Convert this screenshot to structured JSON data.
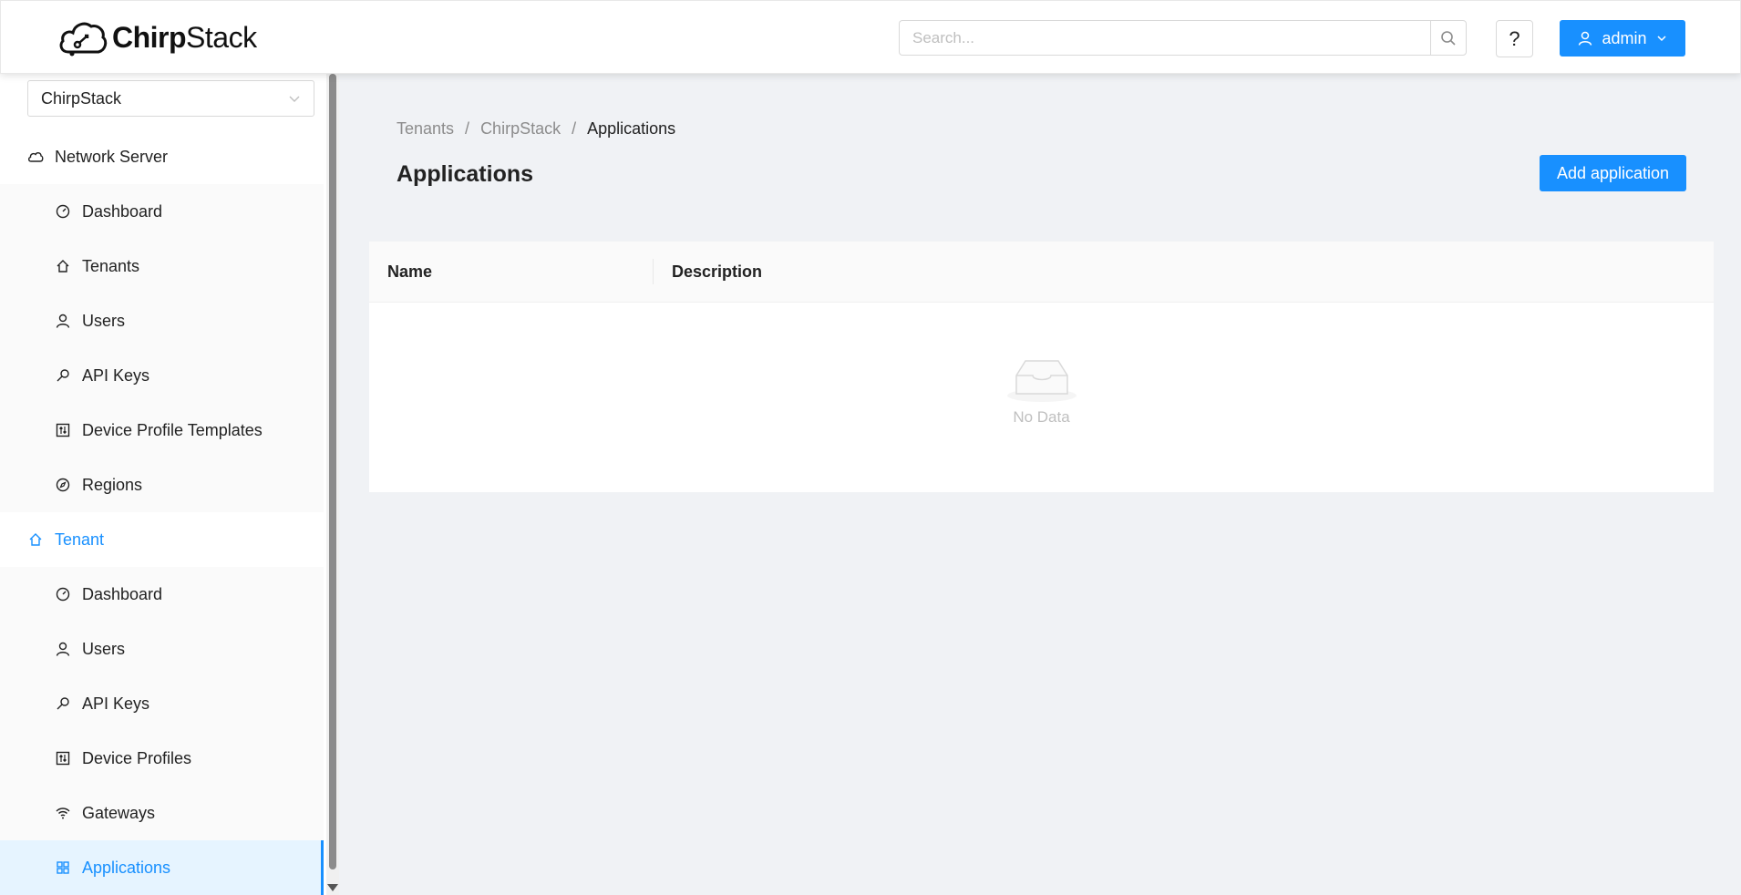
{
  "header": {
    "logo_text_bold": "Chirp",
    "logo_text_regular": "Stack",
    "search_placeholder": "Search...",
    "help_label": "?",
    "user_label": "admin"
  },
  "sidebar": {
    "tenant_selected": "ChirpStack",
    "network_server": {
      "label": "Network Server",
      "items": [
        {
          "label": "Dashboard",
          "icon": "dashboard-icon"
        },
        {
          "label": "Tenants",
          "icon": "home-icon"
        },
        {
          "label": "Users",
          "icon": "user-icon"
        },
        {
          "label": "API Keys",
          "icon": "key-icon"
        },
        {
          "label": "Device Profile Templates",
          "icon": "control-icon"
        },
        {
          "label": "Regions",
          "icon": "compass-icon"
        }
      ]
    },
    "tenant": {
      "label": "Tenant",
      "items": [
        {
          "label": "Dashboard",
          "icon": "dashboard-icon"
        },
        {
          "label": "Users",
          "icon": "user-icon"
        },
        {
          "label": "API Keys",
          "icon": "key-icon"
        },
        {
          "label": "Device Profiles",
          "icon": "control-icon"
        },
        {
          "label": "Gateways",
          "icon": "wifi-icon"
        },
        {
          "label": "Applications",
          "icon": "appstore-icon"
        }
      ]
    }
  },
  "breadcrumb": [
    "Tenants",
    "ChirpStack",
    "Applications"
  ],
  "page": {
    "title": "Applications",
    "add_button": "Add application"
  },
  "table": {
    "columns": [
      "Name",
      "Description"
    ],
    "empty_text": "No Data"
  },
  "colors": {
    "primary": "#1890ff",
    "background": "#f0f2f5"
  }
}
